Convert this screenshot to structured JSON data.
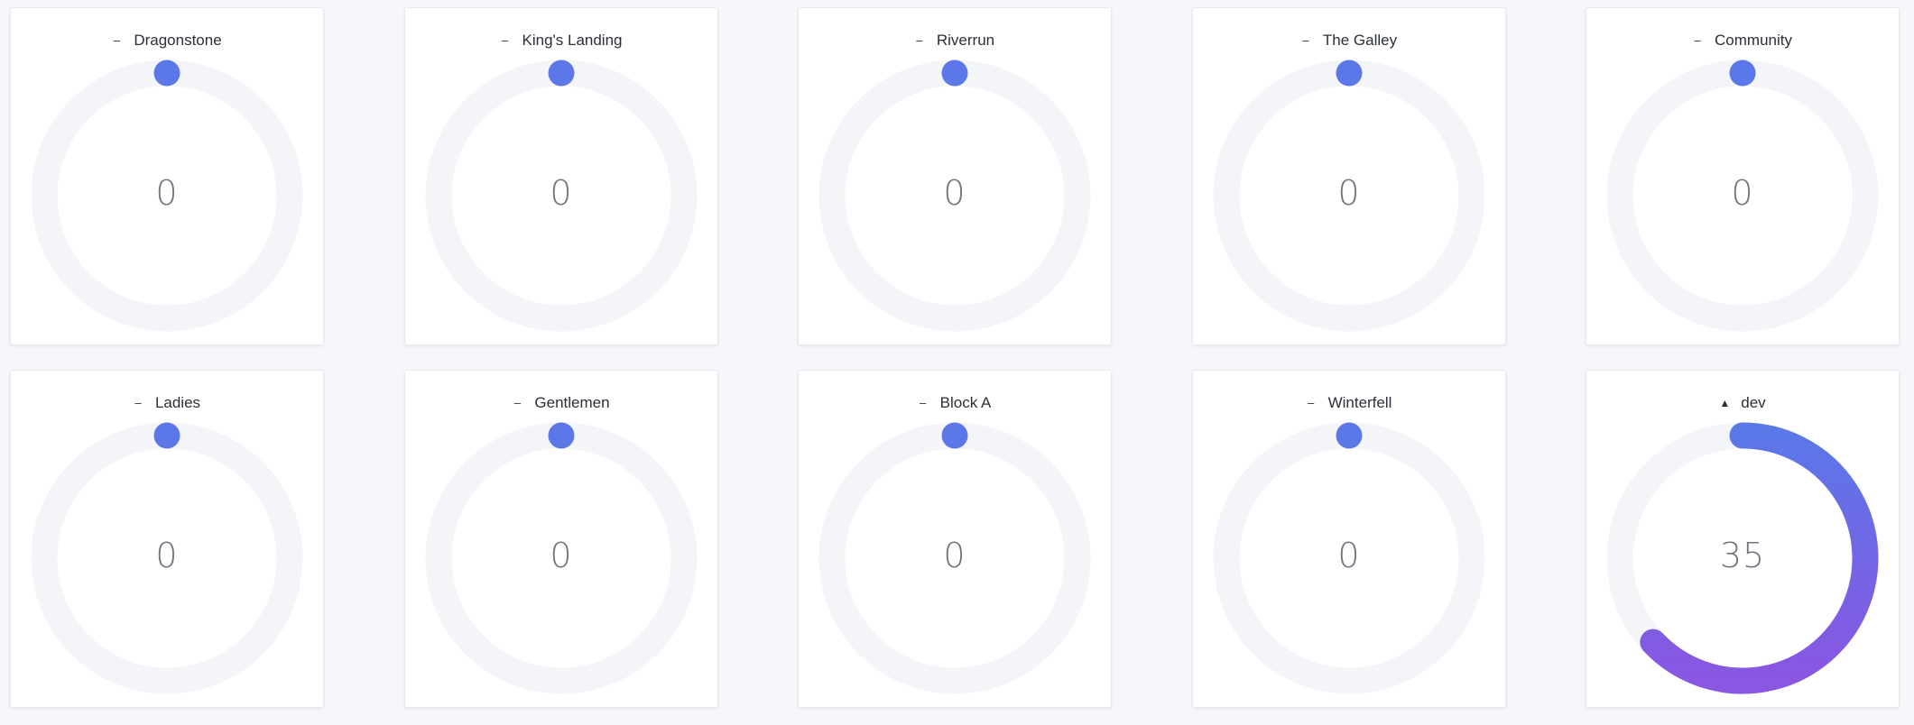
{
  "colors": {
    "accent_start": "#5b77e8",
    "accent_end": "#8a56e2",
    "track": "#f4f5f8"
  },
  "gauges": [
    {
      "name": "Dragonstone",
      "value": "0",
      "level": 0,
      "trend": "–"
    },
    {
      "name": "King's Landing",
      "value": "0",
      "level": 0,
      "trend": "–"
    },
    {
      "name": "Riverrun",
      "value": "0",
      "level": 0,
      "trend": "–"
    },
    {
      "name": "The Galley",
      "value": "0",
      "level": 0,
      "trend": "–"
    },
    {
      "name": "Community",
      "value": "0",
      "level": 0,
      "trend": "–"
    },
    {
      "name": "Ladies",
      "value": "0",
      "level": 0,
      "trend": "–"
    },
    {
      "name": "Gentlemen",
      "value": "0",
      "level": 0,
      "trend": "–"
    },
    {
      "name": "Block A",
      "value": "0",
      "level": 0,
      "trend": "–"
    },
    {
      "name": "Winterfell",
      "value": "0",
      "level": 0,
      "trend": "–"
    },
    {
      "name": "dev",
      "value": "35",
      "level": 0.63,
      "trend": "▲"
    }
  ]
}
